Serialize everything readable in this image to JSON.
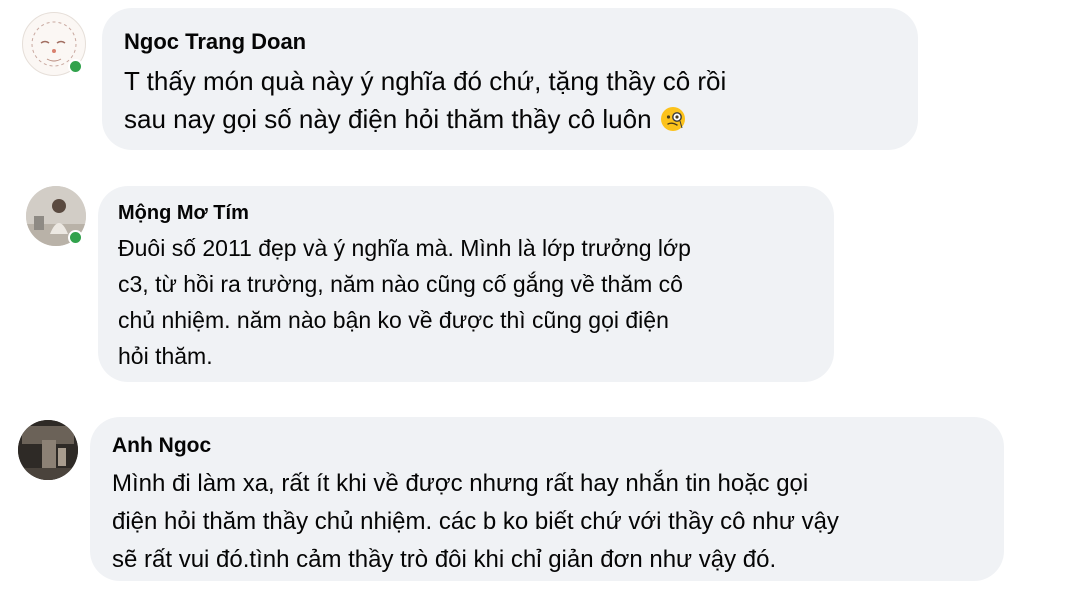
{
  "comments": [
    {
      "author": "Ngoc Trang Doan",
      "lines": [
        "T thấy món quà này ý nghĩa đó chứ, tặng thầy cô rồi",
        "sau nay gọi số này điện hỏi thăm thầy cô luôn"
      ],
      "emoji": "face-with-monocle-icon",
      "online": true
    },
    {
      "author": "Mộng Mơ Tím",
      "lines": [
        "Đuôi số 2011 đẹp và ý nghĩa mà. Mình là lớp trưởng lớp",
        "c3, từ hồi ra trường, năm nào cũng cố gắng về thăm cô",
        "chủ nhiệm. năm nào bận ko về được thì cũng gọi điện",
        "hỏi thăm."
      ],
      "online": true
    },
    {
      "author": "Anh Ngoc",
      "lines": [
        "Mình đi làm xa, rất ít khi về được nhưng rất hay nhắn tin hoặc gọi",
        "điện hỏi thăm thầy chủ nhiệm. các b ko biết chứ với thầy cô như vậy",
        "sẽ rất vui đó.tình cảm thầy trò đôi khi chỉ giản đơn như vậy đó."
      ],
      "online": false
    }
  ],
  "colors": {
    "bubble_bg": "#f0f2f5",
    "text": "#050505",
    "online": "#31a24c"
  }
}
